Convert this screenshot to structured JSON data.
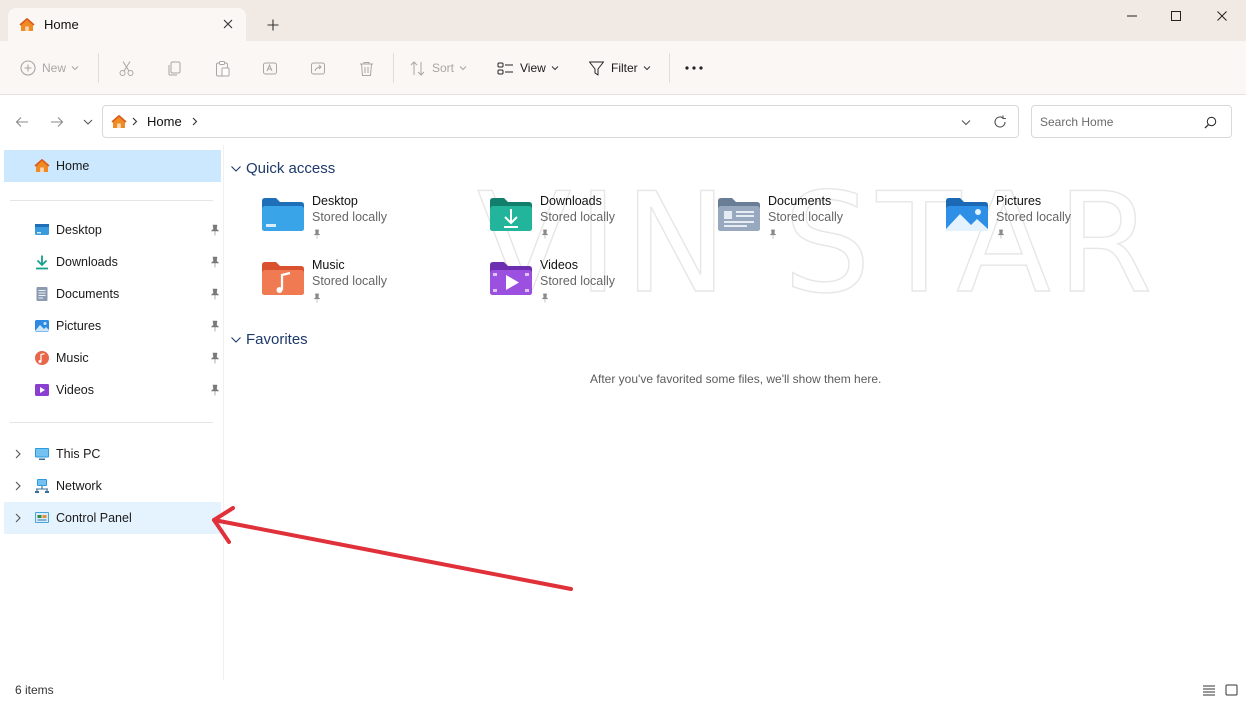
{
  "tab": {
    "title": "Home"
  },
  "toolbar": {
    "new_label": "New",
    "sort_label": "Sort",
    "view_label": "View",
    "filter_label": "Filter"
  },
  "address": {
    "location": "Home"
  },
  "search": {
    "placeholder": "Search Home"
  },
  "sidebar": {
    "home_label": "Home",
    "pinned": [
      {
        "label": "Desktop",
        "icon": "desktop-icon"
      },
      {
        "label": "Downloads",
        "icon": "downloads-icon"
      },
      {
        "label": "Documents",
        "icon": "documents-icon"
      },
      {
        "label": "Pictures",
        "icon": "pictures-icon"
      },
      {
        "label": "Music",
        "icon": "music-icon"
      },
      {
        "label": "Videos",
        "icon": "videos-icon"
      }
    ],
    "locations": [
      {
        "label": "This PC",
        "icon": "this-pc-icon"
      },
      {
        "label": "Network",
        "icon": "network-icon"
      },
      {
        "label": "Control Panel",
        "icon": "control-panel-icon"
      }
    ]
  },
  "main": {
    "quick_access_title": "Quick access",
    "quick_access": [
      {
        "name": "Desktop",
        "status": "Stored locally"
      },
      {
        "name": "Downloads",
        "status": "Stored locally"
      },
      {
        "name": "Documents",
        "status": "Stored locally"
      },
      {
        "name": "Pictures",
        "status": "Stored locally"
      },
      {
        "name": "Music",
        "status": "Stored locally"
      },
      {
        "name": "Videos",
        "status": "Stored locally"
      }
    ],
    "favorites_title": "Favorites",
    "favorites_empty": "After you've favorited some files, we'll show them here."
  },
  "watermark": "VIN STAR",
  "statusbar": {
    "items_count": "6 items"
  },
  "colors": {
    "accent": "#0067c0",
    "selection": "#cce8ff",
    "annotation_arrow": "#e0303a"
  }
}
